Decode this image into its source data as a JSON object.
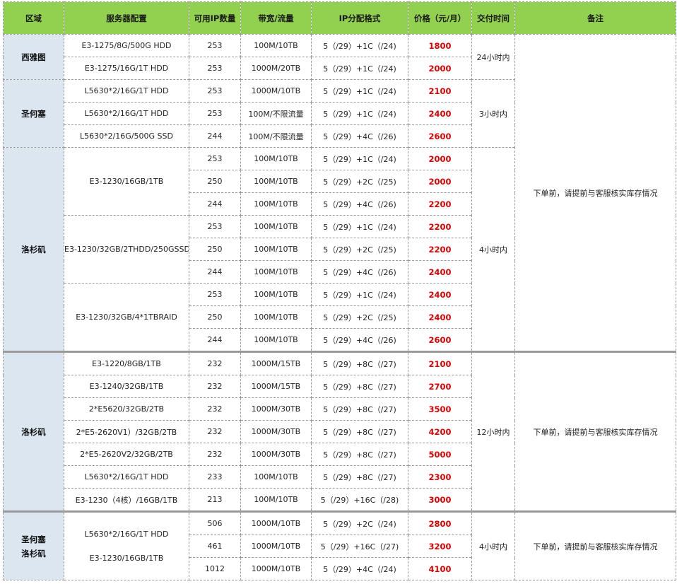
{
  "headers": [
    "区域",
    "服务器配置",
    "可用IP数量",
    "带宽/流量",
    "IP分配格式",
    "价格（元/月）",
    "交付时间",
    "备注"
  ],
  "rows": [
    {
      "config": "E3-1275/8G/500G HDD",
      "ips": "253",
      "bandwidth": "100M/10TB",
      "ipformat": "5（/29）+1C（/24)",
      "price": "1800"
    },
    {
      "config": "E3-1275/16G/1T HDD",
      "ips": "253",
      "bandwidth": "1000M/20TB",
      "ipformat": "5（/29）+1C（/24)",
      "price": "2000"
    },
    {
      "config": "L5630*2/16G/1T HDD",
      "ips": "253",
      "bandwidth": "1000M/10TB",
      "ipformat": "5（/29）+1C（/24)",
      "price": "2100"
    },
    {
      "config": "L5630*2/16G/1T HDD",
      "ips": "253",
      "bandwidth": "100M/不限流量",
      "ipformat": "5（/29）+1C（/24)",
      "price": "2400"
    },
    {
      "config": "L5630*2/16G/500G SSD",
      "ips": "244",
      "bandwidth": "100M/不限流量",
      "ipformat": "5（/29）+4C（/26)",
      "price": "2600"
    },
    {
      "ips": "253",
      "bandwidth": "100M/10TB",
      "ipformat": "5（/29）+1C（/24)",
      "price": "2000"
    },
    {
      "ips": "250",
      "bandwidth": "100M/10TB",
      "ipformat": "5（/29）+2C（/25)",
      "price": "2000"
    },
    {
      "ips": "244",
      "bandwidth": "100M/10TB",
      "ipformat": "5（/29）+4C（/26)",
      "price": "2200"
    },
    {
      "ips": "253",
      "bandwidth": "100M/10TB",
      "ipformat": "5（/29）+1C（/24)",
      "price": "2200"
    },
    {
      "ips": "250",
      "bandwidth": "100M/10TB",
      "ipformat": "5（/29）+2C（/25)",
      "price": "2200"
    },
    {
      "ips": "244",
      "bandwidth": "100M/10TB",
      "ipformat": "5（/29）+4C（/26)",
      "price": "2400"
    },
    {
      "ips": "253",
      "bandwidth": "100M/10TB",
      "ipformat": "5（/29）+1C（/24)",
      "price": "2400"
    },
    {
      "ips": "250",
      "bandwidth": "100M/10TB",
      "ipformat": "5（/29）+2C（/25)",
      "price": "2400"
    },
    {
      "ips": "244",
      "bandwidth": "100M/10TB",
      "ipformat": "5（/29）+4C（/26)",
      "price": "2600"
    },
    {
      "config": "E3-1220/8GB/1TB",
      "ips": "232",
      "bandwidth": "1000M/15TB",
      "ipformat": "5（/29）+8C（/27)",
      "price": "2100"
    },
    {
      "config": "E3-1240/32GB/1TB",
      "ips": "232",
      "bandwidth": "1000M/15TB",
      "ipformat": "5（/29）+8C（/27)",
      "price": "2700"
    },
    {
      "config": "2*E5620/32GB/2TB",
      "ips": "232",
      "bandwidth": "1000M/30TB",
      "ipformat": "5（/29）+8C（/27)",
      "price": "3500"
    },
    {
      "config": "2*E5-2620V1）/32GB/2TB",
      "ips": "232",
      "bandwidth": "1000M/30TB",
      "ipformat": "5（/29）+8C（/27)",
      "price": "4200"
    },
    {
      "config": "2*E5-2620V2/32GB/2TB",
      "ips": "232",
      "bandwidth": "1000M/30TB",
      "ipformat": "5（/29）+8C（/27)",
      "price": "5000"
    },
    {
      "config": "L5630*2/16G/1T HDD",
      "ips": "233",
      "bandwidth": "100M/10TB",
      "ipformat": "5（/29）+8C（/27)",
      "price": "2300"
    },
    {
      "config": "E3-1230（4核）/16GB/1TB",
      "ips": "213",
      "bandwidth": "100M/10TB",
      "ipformat": "5（/29）+16C（/28)",
      "price": "3000"
    },
    {
      "ips": "506",
      "bandwidth": "1000M/10TB",
      "ipformat": "5（/29）+2C（/24)",
      "price": "2800"
    },
    {
      "ips": "461",
      "bandwidth": "1000M/10TB",
      "ipformat": "5（/29）+16C（/27)",
      "price": "3200"
    },
    {
      "ips": "1012",
      "bandwidth": "1000M/10TB",
      "ipformat": "5（/29）+4C（/24)",
      "price": "4100"
    }
  ],
  "regions": {
    "seattle": "西雅图",
    "sanjose": "圣何塞",
    "la1": "洛杉矶",
    "la2": "洛杉矶",
    "combo_line1": "圣何塞",
    "combo_line2": "洛杉矶"
  },
  "merged_configs": {
    "la_a": "E3-1230/16GB/1TB",
    "la_b": "E3-1230/32GB/2THDD/250GSSD",
    "la_c": "E3-1230/32GB/4*1TBRAID",
    "combo_line1": "L5630*2/16G/1T HDD",
    "combo_line2": "E3-1230/16GB/1TB"
  },
  "delivery": {
    "g1": "24小时内",
    "g2": "3小时内",
    "g3": "4小时内",
    "g4": "12小时内",
    "g5": "4小时内"
  },
  "notes": {
    "n1": "下单前，请提前与客服核实库存情况",
    "n2": "下单前，请提前与客服核实库存情况",
    "n3": "下单前，请提前与客服核实库存情况"
  },
  "colors": {
    "header_bg": "#92d050",
    "region_bg": "#dce6f1",
    "price": "#e00000"
  }
}
